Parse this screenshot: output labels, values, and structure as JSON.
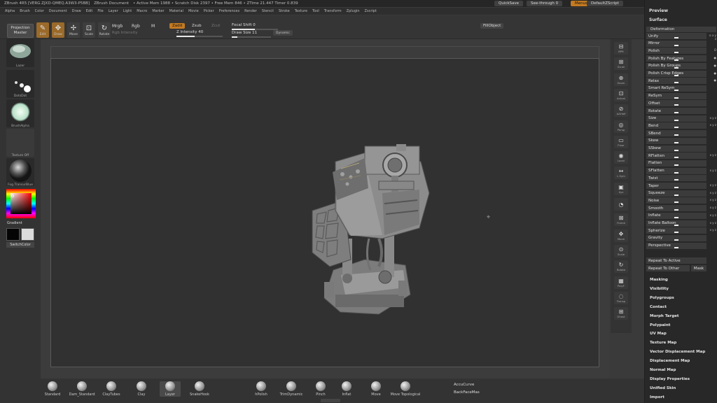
{
  "titlebar": {
    "app": "ZBrush 4R5 [VERG.ZJXD-QMEQ.A3W3-P5BB]",
    "doc": "ZBrush Document",
    "stats": "• Active Mem 1988 • Scratch Disk 2397 • Free Mem 846 • ZTime 21.447 Timer 0.839",
    "quicksave": "QuickSave",
    "seethrough": "See-through 0",
    "menus_btn": "Menus",
    "script": "DefaultZScript"
  },
  "menubar": [
    "Alpha",
    "Brush",
    "Color",
    "Document",
    "Draw",
    "Edit",
    "File",
    "Layer",
    "Light",
    "Macro",
    "Marker",
    "Material",
    "Movie",
    "Picker",
    "Preferences",
    "Render",
    "Stencil",
    "Stroke",
    "Texture",
    "Tool",
    "Transform",
    "Zplugin",
    "Zscript"
  ],
  "topshelf": {
    "projection": [
      "Projection",
      "Master"
    ],
    "tools": [
      {
        "label": "Edit",
        "glyph": "✎",
        "active": true
      },
      {
        "label": "Draw",
        "glyph": "✥",
        "active": true
      },
      {
        "label": "Move",
        "glyph": "✢",
        "active": false
      },
      {
        "label": "Scale",
        "glyph": "⊡",
        "active": false
      },
      {
        "label": "Rotate",
        "glyph": "↻",
        "active": false
      }
    ],
    "mrgb": "Mrgb",
    "rgb": "Rgb",
    "m": "M",
    "rgb_intensity": "Rgb Intensity",
    "zadd": "Zadd",
    "zsub": "Zsub",
    "zcut": "Zcut",
    "z_intensity": "Z Intensity 40",
    "focal_shift": "Focal Shift 0",
    "draw_size": "Draw Size 11",
    "dynamic": "Dynamic",
    "fillobject": "FillObject"
  },
  "leftshelf": {
    "items": [
      "Lazer",
      "DotsDot",
      "BrushAlpha",
      "Texture Off",
      "Fog.TransurBlue"
    ],
    "gradient": "Gradient",
    "switchcolor": "SwitchColor"
  },
  "rightshelf": [
    {
      "g": "⊟",
      "t": "BPR"
    },
    {
      "g": "⊞",
      "t": "Scroll"
    },
    {
      "g": "⊕",
      "t": "Zoom"
    },
    {
      "g": "⊡",
      "t": "Actual"
    },
    {
      "g": "⊘",
      "t": "AAHalf"
    },
    {
      "g": "◎",
      "t": "Persp"
    },
    {
      "g": "▭",
      "t": "Floor"
    },
    {
      "g": "◉",
      "t": "Local"
    },
    {
      "g": "↔",
      "t": "L.Sym"
    },
    {
      "g": "▣",
      "t": "Xyz"
    },
    {
      "g": "◔",
      "t": ""
    },
    {
      "g": "⊠",
      "t": "Frame"
    },
    {
      "g": "✥",
      "t": "Move"
    },
    {
      "g": "⊙",
      "t": "Scale"
    },
    {
      "g": "↻",
      "t": "Rotate"
    },
    {
      "g": "▦",
      "t": "PolyF"
    },
    {
      "g": "◌",
      "t": "Transp"
    },
    {
      "g": "⊞",
      "t": "Ghost"
    }
  ],
  "tray": {
    "preview": "Preview",
    "surface": "Surface",
    "deformation": "Deformation",
    "rows": [
      {
        "label": "Unify",
        "side": "⊙ x y z"
      },
      {
        "label": "Mirror",
        "side": ""
      },
      {
        "label": "Polish",
        "side": "O"
      },
      {
        "label": "Polish By Features",
        "side": "●"
      },
      {
        "label": "Polish By Groups",
        "side": "●"
      },
      {
        "label": "Polish Crisp Edges",
        "side": "●"
      },
      {
        "label": "Relax",
        "side": "●"
      },
      {
        "label": "Smart ReSym",
        "side": ""
      },
      {
        "label": "ReSym",
        "side": ""
      },
      {
        "label": "Offset",
        "side": ""
      },
      {
        "label": "Rotate",
        "side": ""
      },
      {
        "label": "Size",
        "side": "x y z"
      },
      {
        "label": "Bend",
        "side": "x y z"
      },
      {
        "label": "SBend",
        "side": ""
      },
      {
        "label": "Skew",
        "side": ""
      },
      {
        "label": "SSkew",
        "side": ""
      },
      {
        "label": "RFlatten",
        "side": "x y z"
      },
      {
        "label": "Flatten",
        "side": ""
      },
      {
        "label": "SFlatten",
        "side": "x y z"
      },
      {
        "label": "Twist",
        "side": ""
      },
      {
        "label": "Taper",
        "side": "x y z"
      },
      {
        "label": "Squeeze",
        "side": "x y z"
      },
      {
        "label": "Noise",
        "side": "x y z"
      },
      {
        "label": "Smooth",
        "side": "x y z"
      },
      {
        "label": "Inflate",
        "side": "x y z"
      },
      {
        "label": "Inflate Balloon",
        "side": "x y z"
      },
      {
        "label": "Spherize",
        "side": "x y z"
      },
      {
        "label": "Gravity",
        "side": ""
      },
      {
        "label": "Perspective",
        "side": ""
      }
    ],
    "repeat_active": "Repeat To Active",
    "repeat_other": "Repeat To Other",
    "mask": "Mask",
    "subpalettes": [
      "Masking",
      "Visibility",
      "Polygroups",
      "Contact",
      "Morph Target",
      "Polypaint",
      "UV Map",
      "Texture Map",
      "Vector Displacement Map",
      "Displacement Map",
      "Normal Map",
      "Display Properties",
      "Unified Skin",
      "Import"
    ]
  },
  "bottomshelf": {
    "brushes": [
      {
        "name": "Standard",
        "sel": false
      },
      {
        "name": "Dam_Standard",
        "sel": false
      },
      {
        "name": "ClayTubes",
        "sel": false
      },
      {
        "name": "Clay",
        "sel": false
      },
      {
        "name": "Layer",
        "sel": true
      },
      {
        "name": "SnakeHook",
        "sel": false
      },
      {
        "name": "hPolish",
        "sel": false
      },
      {
        "name": "TrimDynamic",
        "sel": false
      },
      {
        "name": "Pinch",
        "sel": false
      },
      {
        "name": "Inflat",
        "sel": false
      },
      {
        "name": "Move",
        "sel": false
      },
      {
        "name": "Move Topological",
        "sel": false
      }
    ],
    "accucurve": "AccuCurve",
    "backfacemask": "BackFaceMas"
  },
  "colors": {
    "accent": "#c27a22",
    "canvas": "#313131",
    "panel": "#333333"
  }
}
